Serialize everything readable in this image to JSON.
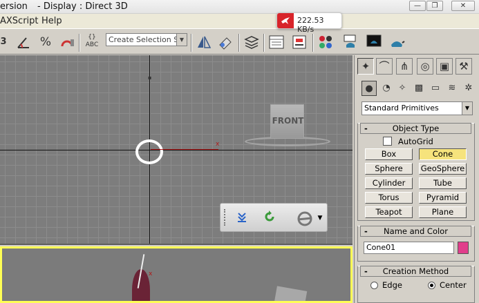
{
  "window": {
    "title_left": "ersion",
    "title_right": "- Display : Direct 3D",
    "minimize_glyph": "—",
    "maximize_glyph": "❐",
    "close_glyph": "✕"
  },
  "speed_widget": {
    "value": "222.53 KB/s",
    "icon": "bird-icon",
    "color": "#d8242a"
  },
  "menubar": {
    "items": [
      "AXScript",
      "Help"
    ]
  },
  "toolbar": {
    "selection_set_placeholder": "Create Selection Set",
    "icons": [
      "link-icon",
      "bind-spacewarp-icon",
      "percent-snap-icon",
      "spinner-snap-icon",
      "named-selection-icon",
      "mirror-icon",
      "align-icon",
      "layer-manager-icon",
      "curve-editor-icon",
      "schematic-view-icon",
      "material-editor-icon",
      "render-setup-icon",
      "render-frame-icon",
      "quick-render-icon"
    ],
    "snap_label": "3",
    "percent_label": "%",
    "abc_label": "ABC"
  },
  "viewport_front": {
    "viewcube_label": "FRONT",
    "axis_marker": "x"
  },
  "floating_toolbar": {
    "icons": [
      "download-icon",
      "refresh-icon",
      "ie-icon"
    ]
  },
  "viewport_persp": {
    "axis_marker": "x"
  },
  "command_panel": {
    "tabs": [
      "create-tab",
      "modify-tab",
      "hierarchy-tab",
      "motion-tab",
      "display-tab",
      "utilities-tab"
    ],
    "categories": [
      "geometry",
      "shapes",
      "lights",
      "cameras",
      "helpers",
      "space-warps",
      "systems"
    ],
    "category_dropdown": "Standard Primitives",
    "object_type": {
      "title": "Object Type",
      "autogrid_label": "AutoGrid",
      "autogrid_checked": false,
      "buttons": [
        "Box",
        "Cone",
        "Sphere",
        "GeoSphere",
        "Cylinder",
        "Tube",
        "Torus",
        "Pyramid",
        "Teapot",
        "Plane"
      ],
      "active_button": "Cone",
      "active_color": "#f6e37c"
    },
    "name_and_color": {
      "title": "Name and Color",
      "name_value": "Cone01",
      "color": "#e13e8b"
    },
    "creation_method": {
      "title": "Creation Method",
      "options": [
        "Edge",
        "Center"
      ],
      "selected": "Center"
    }
  }
}
